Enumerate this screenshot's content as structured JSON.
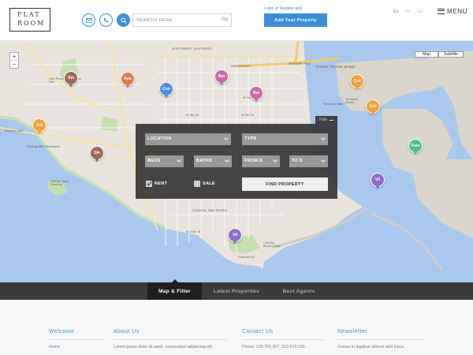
{
  "header": {
    "logo_line1": "FLAT",
    "logo_line2": "ROOM",
    "search_placeholder": "Search here",
    "search_go": "Go",
    "login_label": "Login",
    "or_label": "or",
    "register_label": "Register",
    "and_label": "and",
    "add_property_label": "Add Your Property",
    "languages": [
      "En",
      "Fr",
      "Ge"
    ],
    "active_language": "En",
    "menu_label": "MENU",
    "accent_color": "#3b8fd9"
  },
  "map": {
    "map_button": "Map",
    "satellite_button": "Satellite",
    "zoom_in": "+",
    "zoom_out": "−",
    "labels": {
      "northwest_san_pedro": "NORTHWEST SAN PEDRO",
      "san_pedro_faa": "San Pedro FAA Radar Site",
      "rolling_hills": "Rolling Hills Palisades",
      "san_pedro": "SAN PEDRO",
      "coastal_san_pedro": "COASTAL SAN PEDRO",
      "ocean_trails": "Ocean Trails Reserve",
      "terminal_island": "Terminal Island",
      "cabrillo_beach": "Cabrillo Beach Park",
      "seaside_fwy": "Seaside Fwy",
      "vincent_thomas": "Vincent Thomas Bridge",
      "w_15th": "W 15th St",
      "w_9th": "W 9th St",
      "w_25th": "W 25th St",
      "shepard_st": "Shepard St",
      "w_1st": "W 1st St",
      "terminal_way": "Terminal Way",
      "palos_verdes": "Palos Verdes Dr S",
      "western_ave": "Western Ave"
    },
    "pins": [
      {
        "label": "Sin",
        "color": "#9b6a55"
      },
      {
        "label": "Apa",
        "color": "#e5784b"
      },
      {
        "label": "Con",
        "color": "#4a90d9"
      },
      {
        "label": "Bui",
        "color": "#c66aa8"
      },
      {
        "label": "Bui",
        "color": "#c66aa8"
      },
      {
        "label": "Cot",
        "color": "#f0a23b"
      },
      {
        "label": "Cot",
        "color": "#f0a23b"
      },
      {
        "label": "Cot",
        "color": "#f0a23b"
      },
      {
        "label": "Sin",
        "color": "#9b6a55"
      },
      {
        "label": "Fam",
        "color": "#4ebf8f"
      },
      {
        "label": "Vil",
        "color": "#8c6fc8"
      },
      {
        "label": "Vil",
        "color": "#8c6fc8"
      }
    ]
  },
  "filter": {
    "hide_label": "Hide",
    "location": "Location",
    "type": "Type",
    "beds": "Beds",
    "baths": "Baths",
    "from": "From $",
    "to": "To $",
    "rent_label": "Rent",
    "rent_checked": true,
    "sale_label": "Sale",
    "sale_checked": false,
    "find_label": "Find Property"
  },
  "tabs": [
    {
      "label": "Map & Filter",
      "active": true
    },
    {
      "label": "Latest Properties",
      "active": false
    },
    {
      "label": "Best Agents",
      "active": false
    }
  ],
  "footer": {
    "welcome": {
      "title": "Welcome",
      "text": "Home"
    },
    "about": {
      "title": "About Us",
      "text": "Lorem ipsum dolor sit amet, consectetur adipiscing elit."
    },
    "contact": {
      "title": "Contact Us",
      "text": "Phone: 135-791-357, 913-579-135."
    },
    "newsletter": {
      "title": "Newsletter",
      "text": "Cursus in dapibus ultrices velit fusce."
    }
  }
}
